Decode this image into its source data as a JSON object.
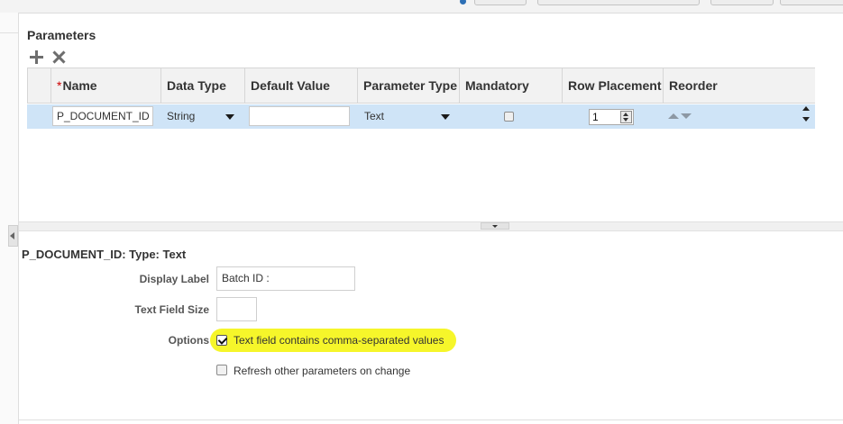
{
  "parameters": {
    "title": "Parameters",
    "columns": [
      {
        "label": "Name",
        "required": true
      },
      {
        "label": "Data Type",
        "required": false
      },
      {
        "label": "Default Value",
        "required": false
      },
      {
        "label": "Parameter Type",
        "required": false
      },
      {
        "label": "Mandatory",
        "required": false
      },
      {
        "label": "Row Placement",
        "required": false
      },
      {
        "label": "Reorder",
        "required": false
      }
    ],
    "required_marker": "*",
    "rows": [
      {
        "name": "P_DOCUMENT_ID",
        "data_type": "String",
        "default_value": "",
        "parameter_type": "Text",
        "mandatory": false,
        "row_placement": "1"
      }
    ]
  },
  "detail": {
    "title": "P_DOCUMENT_ID: Type: Text",
    "display_label_label": "Display Label",
    "display_label_value": "Batch ID :",
    "text_field_size_label": "Text Field Size",
    "text_field_size_value": "",
    "options_label": "Options",
    "options": [
      {
        "label": "Text field contains comma-separated values",
        "checked": true,
        "highlighted": true
      },
      {
        "label": "Refresh other parameters on change",
        "checked": false,
        "highlighted": false
      }
    ]
  },
  "colors": {
    "selected_row": "#cfe4f7",
    "highlight": "#f6f62a",
    "header_bg": "#f2f2f2"
  }
}
